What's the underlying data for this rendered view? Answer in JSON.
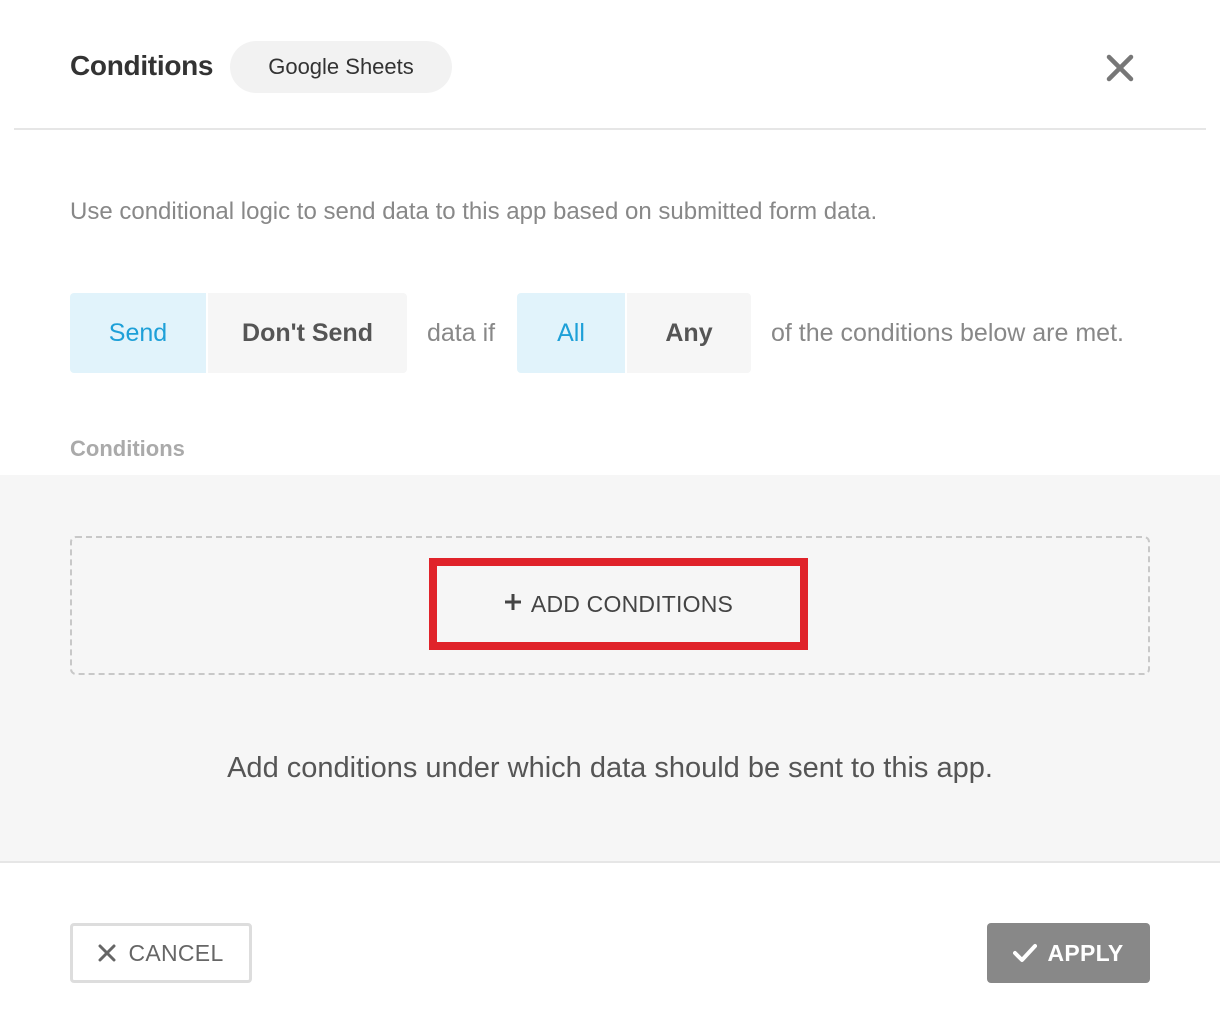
{
  "header": {
    "title": "Conditions",
    "app_tag": "Google Sheets",
    "close_icon": "close-icon"
  },
  "description": "Use conditional logic to send data to this app based on submitted form data.",
  "rule": {
    "action_options": [
      {
        "label": "Send",
        "selected": true
      },
      {
        "label": "Don't Send",
        "selected": false
      }
    ],
    "data_if_text": "data if",
    "match_options": [
      {
        "label": "All",
        "selected": true
      },
      {
        "label": "Any",
        "selected": false
      }
    ],
    "suffix_text": "of the conditions below are met."
  },
  "conditions": {
    "section_label": "Conditions",
    "add_button": {
      "icon": "plus-icon",
      "label": "ADD CONDITIONS"
    },
    "empty_hint": "Add conditions under which data should be sent to this app."
  },
  "footer": {
    "cancel": {
      "icon": "close-icon",
      "label": "CANCEL"
    },
    "apply": {
      "icon": "check-icon",
      "label": "APPLY"
    }
  },
  "colors": {
    "accent": "#1ea0d8",
    "accent_bg": "#e1f3fb",
    "highlight_border": "#e0232a",
    "apply_bg": "#888888",
    "panel_bg": "#f6f6f6"
  }
}
